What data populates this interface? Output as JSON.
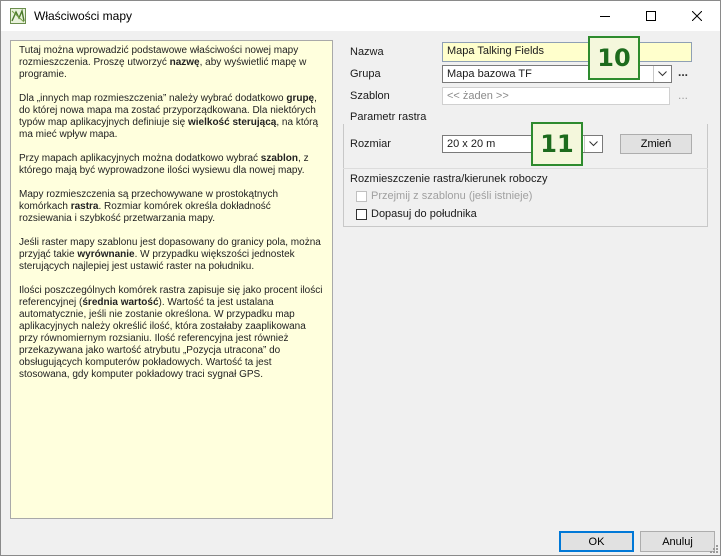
{
  "window": {
    "title": "Właściwości mapy"
  },
  "help": {
    "p1": [
      "Tutaj można wprowadzić podstawowe właściwości nowej mapy rozmieszczenia. Proszę utworzyć ",
      "nazwę",
      ", aby wyświetlić mapę w programie."
    ],
    "p2": [
      "Dla „innych map rozmieszczenia” należy wybrać dodatkowo ",
      "grupę",
      ", do której nowa mapa ma zostać przyporządkowana. Dla niektórych typów map aplikacyjnych definiuje się ",
      "wielkość sterującą",
      ", na którą ma mieć wpływ mapa."
    ],
    "p3": [
      "Przy mapach aplikacyjnych można dodatkowo wybrać ",
      "szablon",
      ", z którego mają być wyprowadzone ilości wysiewu dla nowej mapy."
    ],
    "p4": [
      "Mapy rozmieszczenia są przechowywane w prostokątnych komórkach ",
      "rastra",
      ". Rozmiar komórek określa dokładność rozsiewania i szybkość przetwarzania mapy."
    ],
    "p5": [
      "Jeśli raster mapy szablonu jest dopasowany do granicy pola, można przyjąć takie ",
      "wyrównanie",
      ". W przypadku większości jednostek sterujących najlepiej jest ustawić raster na południku."
    ],
    "p6": [
      "Ilości poszczególnych komórek rastra zapisuje się jako procent ilości referencyjnej (",
      "średnia wartość",
      "). Wartość ta jest ustalana automatycznie, jeśli nie zostanie określona. W przypadku map aplikacyjnych należy określić ilość, która zostałaby zaaplikowana przy równomiernym rozsianiu. Ilość referencyjna jest również przekazywana jako wartość atrybutu „Pozycja utracona” do obsługujących komputerów pokładowych. Wartość ta jest stosowana, gdy komputer pokładowy traci sygnał GPS."
    ]
  },
  "form": {
    "name_label": "Nazwa",
    "name_value": "Mapa Talking Fields",
    "group_label": "Grupa",
    "group_value": "Mapa bazowa TF",
    "template_label": "Szablon",
    "template_value": "<< żaden >>",
    "more_dots": "...",
    "raster_group_label": "Parametr rastra",
    "size_label": "Rozmiar",
    "size_value": "20 x 20 m",
    "change_button": "Zmień",
    "alignment_label": "Rozmieszczenie rastra/kierunek roboczy",
    "adopt_checkbox": "Przejmij z szablonu (jeśli istnieje)",
    "meridian_checkbox": "Dopasuj do południka"
  },
  "badges": {
    "b10": "10",
    "b11": "11"
  },
  "footer": {
    "ok": "OK",
    "cancel": "Anuluj"
  },
  "colors": {
    "help_bg": "#ffffdd",
    "name_field_bg": "#ffffcc",
    "badge_green": "#2e8b2e",
    "primary_border": "#0078d7"
  }
}
